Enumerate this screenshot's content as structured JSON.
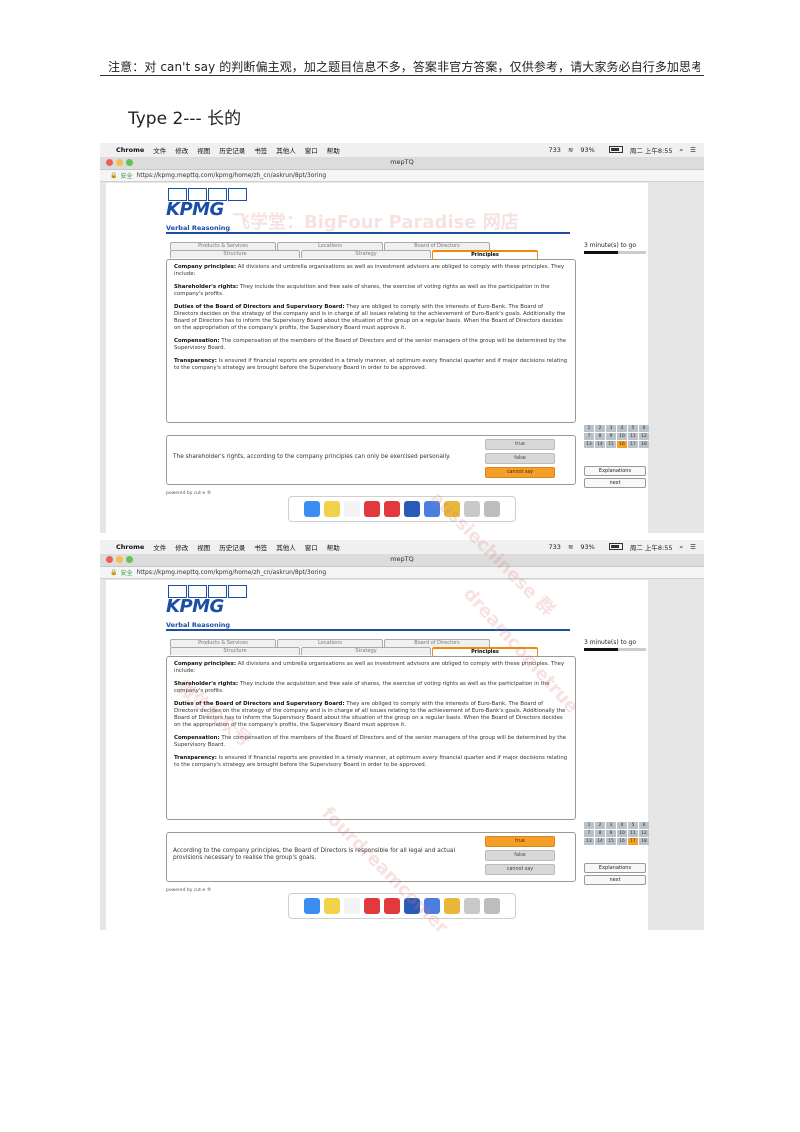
{
  "document": {
    "note": "注意：对 can't say 的判断偏主观，加之题目信息不多，答案非官方答案，仅供参考，请大家务必自行多加思考",
    "type_label": "Type 2---  长的"
  },
  "menubar": {
    "items": [
      "Chrome",
      "文件",
      "修改",
      "视图",
      "历史记录",
      "书签",
      "其他人",
      "窗口",
      "帮助"
    ],
    "status": [
      "733",
      "93%",
      "周二 上午8:55"
    ]
  },
  "browser": {
    "window_title": "mepTQ",
    "secure_label": "安全",
    "url": "https://kpmg.mepttq.com/kpmg/home/zh_cn/askrun/8pt/3oring"
  },
  "kpmg": {
    "logo": "KPMG",
    "section_title": "Verbal Reasoning",
    "tabs_top": [
      "Products & Services",
      "Locations",
      "Board of Directors"
    ],
    "tabs_bottom": [
      "Structure",
      "Strategy",
      "Principles"
    ],
    "passage": [
      {
        "head": "Company principles:",
        "body": "All divisions and umbrella organisations as well as investment advisors are obliged to comply with these principles. They include:"
      },
      {
        "head": "Shareholder's rights:",
        "body": "They include the acquisition and free sale of shares, the exercise of voting rights as well as the participation in the company's profits."
      },
      {
        "head": "Duties of the Board of Directors and Supervisory Board:",
        "body": "They are obliged to comply with the interests of Euro-Bank. The Board of Directors decides on the strategy of the company and is in charge of all issues relating to the achievement of Euro-Bank's goals. Additionally the Board of Directors has to inform the Supervisory Board about the situation of the group on a regular basis. When the Board of Directors decides on the appropriation of the company's profits, the Supervisory Board must approve it."
      },
      {
        "head": "Compensation:",
        "body": "The compensation of the members of the Board of Directors and of the senior managers of the group will be determined by the Supervisory Board."
      },
      {
        "head": "Transparency:",
        "body": "Is ensured if financial reports are provided in a timely manner, at optimum every financial quarter and if major decisions relating to the company's strategy are brought before the Supervisory Board in order to be approved."
      }
    ],
    "answers": [
      "true",
      "false",
      "cannot say"
    ],
    "powered_by": "powered by cut-e ®",
    "timer": "3 minute(s) to go",
    "timer_progress": 0.55,
    "explanations": "Explanations",
    "next": "next",
    "nav_numbers": [
      "1",
      "2",
      "3",
      "4",
      "5",
      "6",
      "7",
      "8",
      "9",
      "10",
      "11",
      "12",
      "13",
      "14",
      "15",
      "16",
      "17",
      "18"
    ]
  },
  "screens": [
    {
      "statement": "The shareholder's rights, according to the company principles can only be exercised personally.",
      "selected": "cannot say",
      "current": "16"
    },
    {
      "statement": "According to the company principles, the Board of Directors is responsible for all legal and actual provisions necessary to realise the group's goals.",
      "selected": "true",
      "current": "17"
    }
  ],
  "dock_icons": [
    "finder-icon",
    "notes-icon",
    "calendar-icon",
    "app-icon",
    "app-icon",
    "word-icon",
    "baidu-icon",
    "chrome-icon",
    "file-icon",
    "trash-icon"
  ],
  "watermarks": [
    "飞学堂：BigFour Paradise 网店",
    "dreamcometrue",
    "aussiechinese 群",
    "fourdreamcomer",
    "微信公众号"
  ],
  "colors": {
    "brand": "#1b4fa3",
    "accent": "#f4a028"
  }
}
